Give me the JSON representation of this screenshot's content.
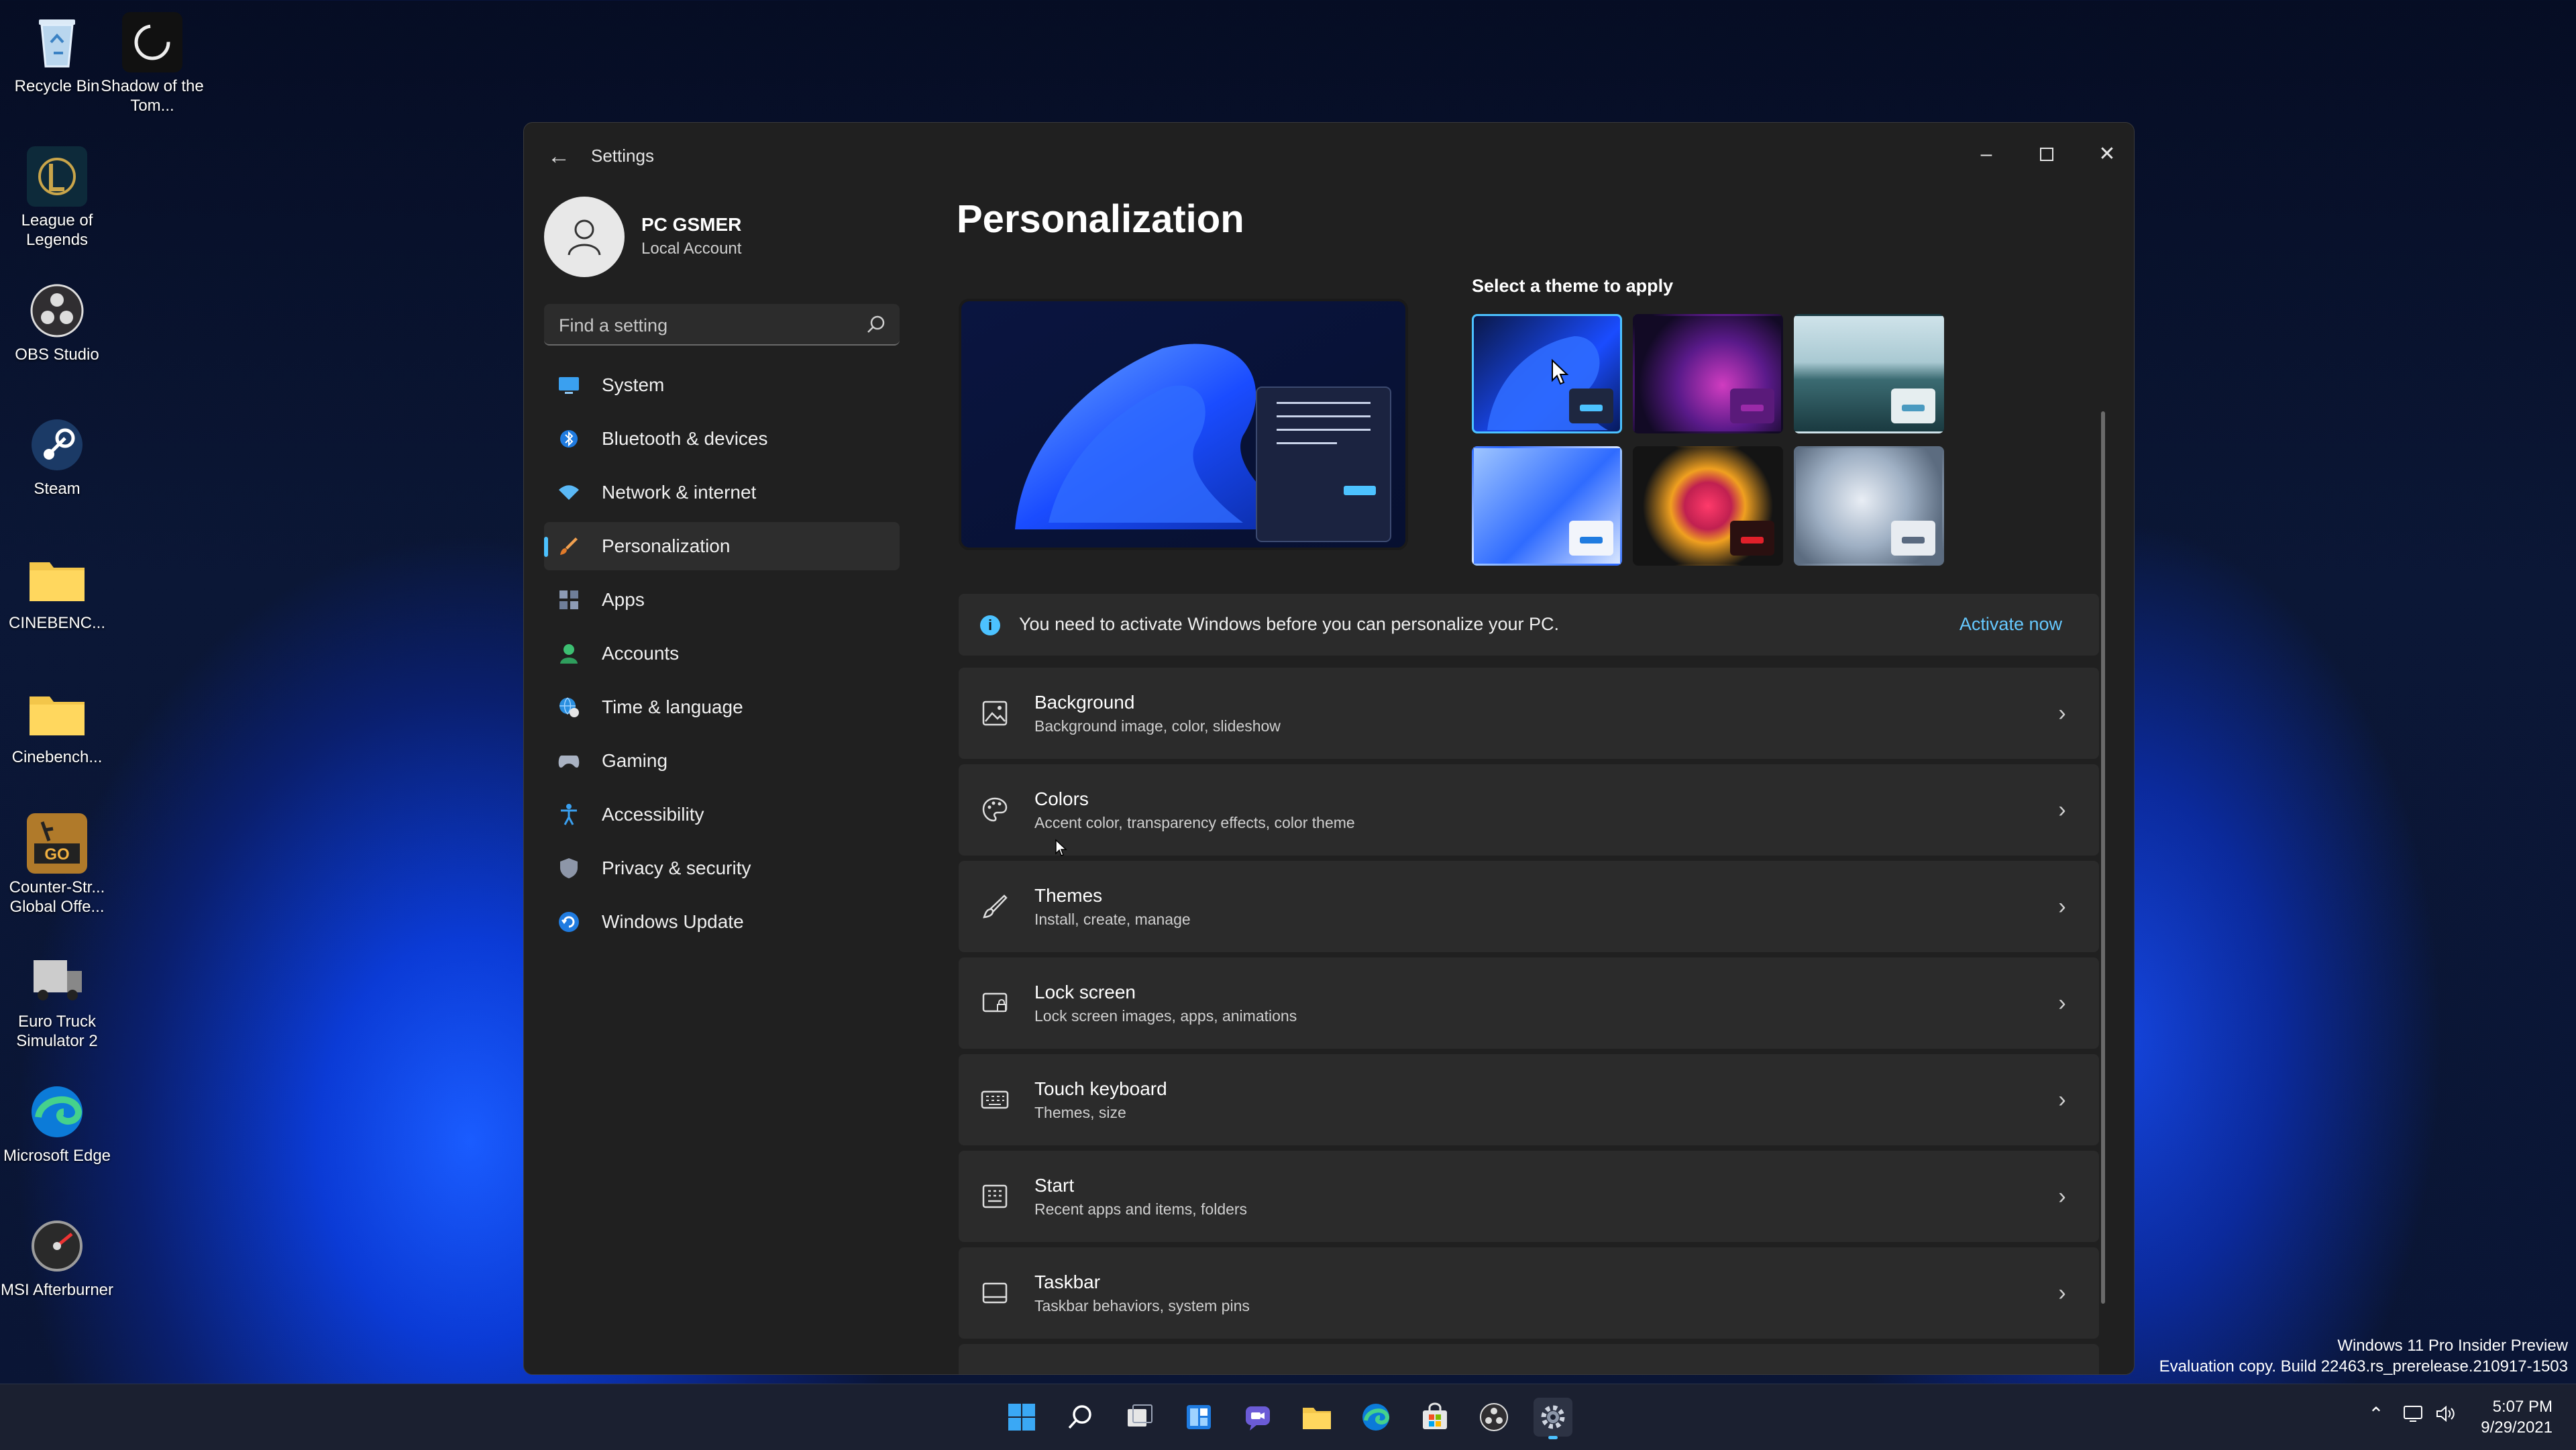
{
  "desktop": {
    "icons": [
      {
        "label": "Recycle Bin"
      },
      {
        "label": "Shadow of the Tom..."
      },
      {
        "label": "League of Legends"
      },
      {
        "label": "OBS Studio"
      },
      {
        "label": "Steam"
      },
      {
        "label": "CINEBENC..."
      },
      {
        "label": "Cinebench..."
      },
      {
        "label": "Counter-Str... Global Offe..."
      },
      {
        "label": "Euro Truck Simulator 2"
      },
      {
        "label": "Microsoft Edge"
      },
      {
        "label": "MSI Afterburner"
      }
    ]
  },
  "window": {
    "title": "Settings",
    "profile": {
      "name": "PC GSMER",
      "account": "Local Account"
    },
    "search": {
      "placeholder": "Find a setting"
    },
    "nav": [
      {
        "label": "System",
        "icon": "monitor-icon"
      },
      {
        "label": "Bluetooth & devices",
        "icon": "bluetooth-icon"
      },
      {
        "label": "Network & internet",
        "icon": "wifi-icon"
      },
      {
        "label": "Personalization",
        "icon": "brush-icon",
        "active": true
      },
      {
        "label": "Apps",
        "icon": "apps-icon"
      },
      {
        "label": "Accounts",
        "icon": "person-icon"
      },
      {
        "label": "Time & language",
        "icon": "globe-clock-icon"
      },
      {
        "label": "Gaming",
        "icon": "controller-icon"
      },
      {
        "label": "Accessibility",
        "icon": "accessibility-icon"
      },
      {
        "label": "Privacy & security",
        "icon": "shield-icon"
      },
      {
        "label": "Windows Update",
        "icon": "update-icon"
      }
    ],
    "page_title": "Personalization",
    "themes_label": "Select a theme to apply",
    "banner": {
      "text": "You need to activate Windows before you can personalize your PC.",
      "action": "Activate now"
    },
    "rows": [
      {
        "title": "Background",
        "subtitle": "Background image, color, slideshow",
        "icon": "image-icon"
      },
      {
        "title": "Colors",
        "subtitle": "Accent color, transparency effects, color theme",
        "icon": "palette-icon"
      },
      {
        "title": "Themes",
        "subtitle": "Install, create, manage",
        "icon": "brush-icon"
      },
      {
        "title": "Lock screen",
        "subtitle": "Lock screen images, apps, animations",
        "icon": "lock-screen-icon"
      },
      {
        "title": "Touch keyboard",
        "subtitle": "Themes, size",
        "icon": "keyboard-icon"
      },
      {
        "title": "Start",
        "subtitle": "Recent apps and items, folders",
        "icon": "start-icon"
      },
      {
        "title": "Taskbar",
        "subtitle": "Taskbar behaviors, system pins",
        "icon": "taskbar-icon"
      }
    ]
  },
  "watermark": {
    "line1": "Windows 11 Pro Insider Preview",
    "line2": "Evaluation copy. Build 22463.rs_prerelease.210917-1503"
  },
  "taskbar": {
    "time": "5:07 PM",
    "date": "9/29/2021"
  },
  "colors": {
    "accent": "#4cc2ff",
    "window_bg": "#202020",
    "card_bg": "#2b2b2b"
  }
}
